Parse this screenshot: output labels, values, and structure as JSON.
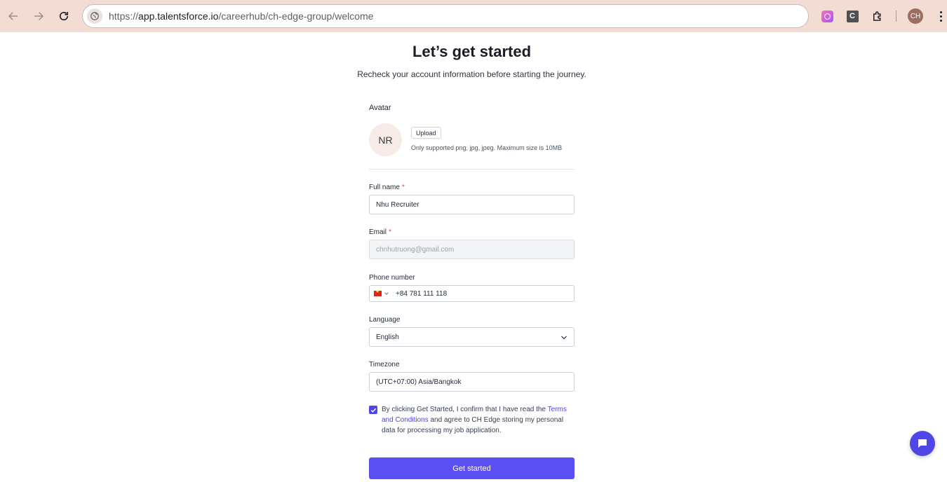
{
  "browser": {
    "url_prefix": "https://",
    "url_host": "app.talentsforce.io",
    "url_path": "/careerhub/ch-edge-group/welcome",
    "profile_initials": "CH",
    "extension_c_letter": "C"
  },
  "page": {
    "title": "Let’s get started",
    "subtitle": "Recheck your account information before starting the journey."
  },
  "avatar": {
    "label": "Avatar",
    "initials": "NR",
    "upload_label": "Upload",
    "hint": "Only supported png, jpg, jpeg. Maximum size is 10MB"
  },
  "fields": {
    "full_name": {
      "label": "Full name",
      "required": "*",
      "value": "Nhu Recruiter"
    },
    "email": {
      "label": "Email",
      "required": "*",
      "value": "chnhutruong@gmail.com"
    },
    "phone": {
      "label": "Phone number",
      "value": "+84 781 111 118",
      "country": "Vietnam"
    },
    "language": {
      "label": "Language",
      "value": "English"
    },
    "timezone": {
      "label": "Timezone",
      "value": "(UTC+07:00) Asia/Bangkok"
    }
  },
  "consent": {
    "checked": true,
    "text_before": "By clicking Get Started, I confirm that I have read the ",
    "link_text": "Terms and Conditions",
    "text_after": " and agree to CH Edge storing my personal data for processing my job application."
  },
  "submit_label": "Get started",
  "colors": {
    "accent": "#5a4ff0",
    "chrome_bg": "#f3dcd3",
    "required": "#ef4444"
  }
}
